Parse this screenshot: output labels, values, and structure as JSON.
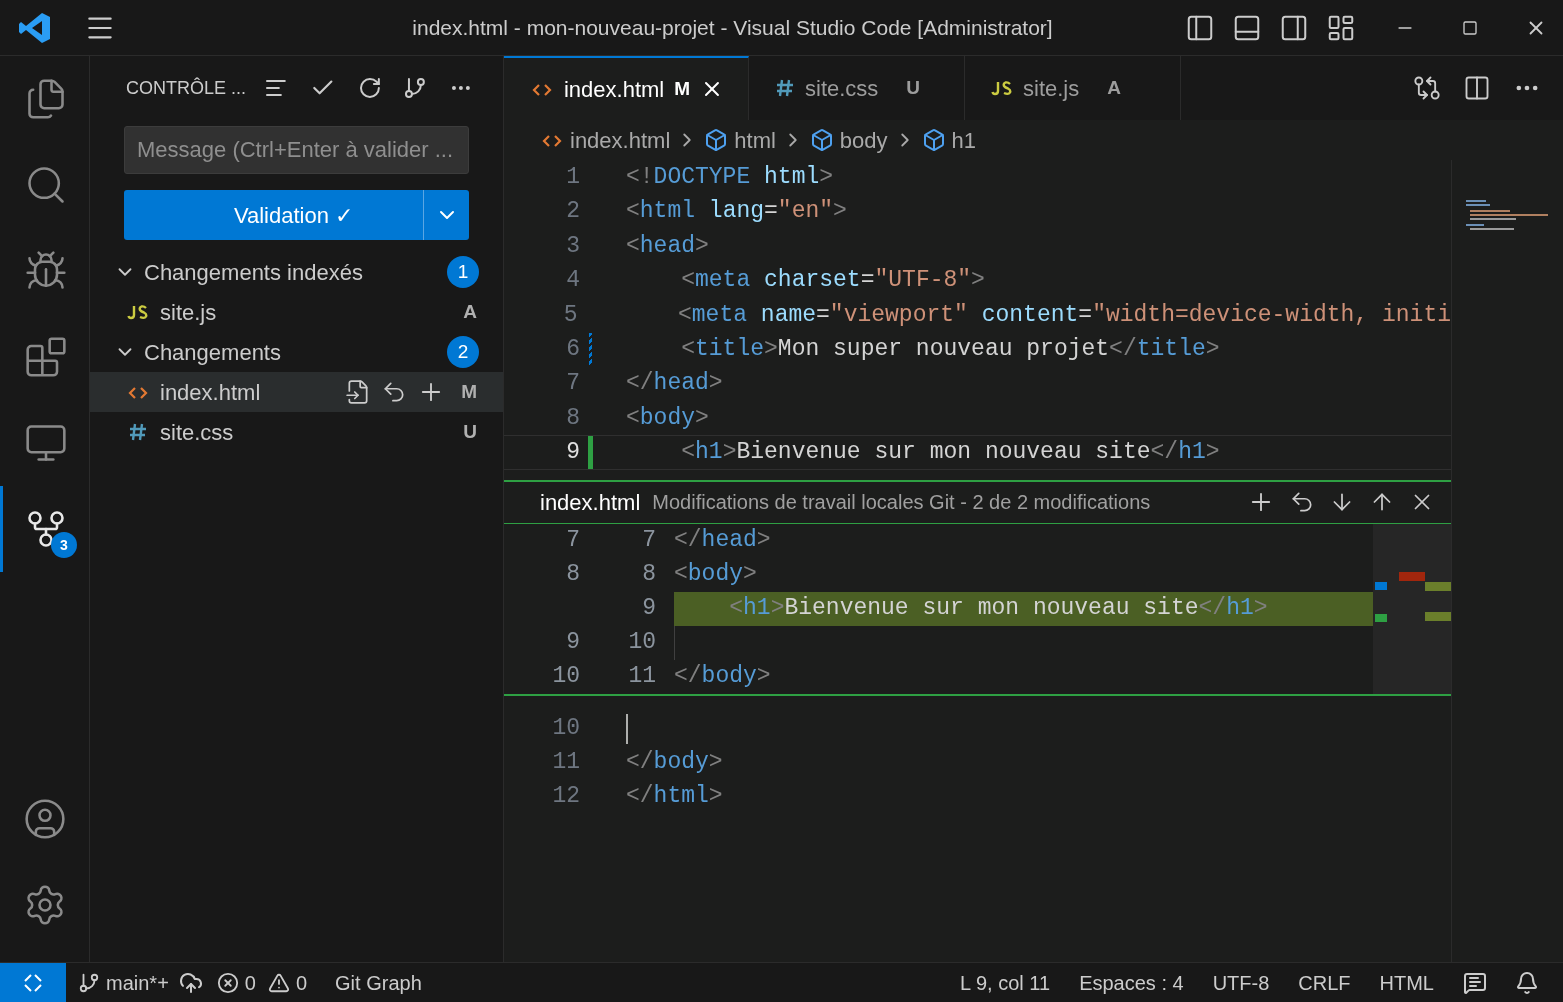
{
  "title_bar": {
    "title": "index.html - mon-nouveau-projet - Visual Studio Code [Administrator]"
  },
  "activity_bar": {
    "items": [
      {
        "kind": "explorer",
        "selected": false
      },
      {
        "kind": "search",
        "selected": false
      },
      {
        "kind": "debug",
        "selected": false
      },
      {
        "kind": "extensions",
        "selected": false
      },
      {
        "kind": "remote",
        "selected": false
      },
      {
        "kind": "scm",
        "selected": true,
        "badge": "3"
      }
    ],
    "bottom": [
      {
        "kind": "account"
      },
      {
        "kind": "settings"
      }
    ]
  },
  "sidebar": {
    "title": "CONTRÔLE ...",
    "message": {
      "placeholder": "Message (Ctrl+Enter à valider ..."
    },
    "commit_button": "Validation ✓",
    "groups": [
      {
        "label": "Changements indexés",
        "count": "1",
        "expanded": true,
        "files": [
          {
            "name": "site.js",
            "kind": "js",
            "status": "A",
            "selected": false
          }
        ]
      },
      {
        "label": "Changements",
        "count": "2",
        "expanded": true,
        "files": [
          {
            "name": "index.html",
            "kind": "html",
            "status": "M",
            "selected": true
          },
          {
            "name": "site.css",
            "kind": "css",
            "status": "U",
            "selected": false
          }
        ]
      }
    ]
  },
  "tabs": [
    {
      "label": "index.html",
      "kind": "html",
      "status": "M",
      "selected": true
    },
    {
      "label": "site.css",
      "kind": "css",
      "status": "U",
      "selected": false
    },
    {
      "label": "site.js",
      "kind": "js",
      "status": "A",
      "selected": false
    }
  ],
  "breadcrumbs": [
    {
      "label": "index.html",
      "kind": "file"
    },
    {
      "label": "html",
      "kind": "element"
    },
    {
      "label": "body",
      "kind": "element"
    },
    {
      "label": "h1",
      "kind": "element"
    }
  ],
  "editor": {
    "lines": [
      {
        "number": "1",
        "tokens": [
          {
            "kind": "bracket",
            "text": "<!"
          },
          {
            "kind": "tag",
            "text": "DOCTYPE"
          },
          {
            "kind": "attr",
            "text": " html"
          },
          {
            "kind": "bracket",
            "text": ">"
          }
        ]
      },
      {
        "number": "2",
        "tokens": [
          {
            "kind": "bracket",
            "text": "<"
          },
          {
            "kind": "tag",
            "text": "html"
          },
          {
            "kind": "attr",
            "text": " lang"
          },
          {
            "kind": "text",
            "text": "="
          },
          {
            "kind": "string",
            "text": "\"en\""
          },
          {
            "kind": "bracket",
            "text": ">"
          }
        ]
      },
      {
        "number": "3",
        "tokens": [
          {
            "kind": "bracket",
            "text": "<"
          },
          {
            "kind": "tag",
            "text": "head"
          },
          {
            "kind": "bracket",
            "text": ">"
          }
        ]
      },
      {
        "number": "4",
        "tokens": [
          {
            "kind": "bracket",
            "text": "    <"
          },
          {
            "kind": "tag",
            "text": "meta"
          },
          {
            "kind": "attr",
            "text": " charset"
          },
          {
            "kind": "text",
            "text": "="
          },
          {
            "kind": "string",
            "text": "\"UTF-8\""
          },
          {
            "kind": "bracket",
            "text": ">"
          }
        ]
      },
      {
        "number": "5",
        "tokens": [
          {
            "kind": "bracket",
            "text": "    <"
          },
          {
            "kind": "tag",
            "text": "meta"
          },
          {
            "kind": "attr",
            "text": " name"
          },
          {
            "kind": "text",
            "text": "="
          },
          {
            "kind": "string",
            "text": "\"viewport\""
          },
          {
            "kind": "attr",
            "text": " content"
          },
          {
            "kind": "text",
            "text": "="
          },
          {
            "kind": "string",
            "text": "\"width=device-width, initi"
          }
        ]
      },
      {
        "number": "6",
        "modified": true,
        "tokens": [
          {
            "kind": "bracket",
            "text": "    <"
          },
          {
            "kind": "tag",
            "text": "title"
          },
          {
            "kind": "bracket",
            "text": ">"
          },
          {
            "kind": "text",
            "text": "Mon super nouveau projet"
          },
          {
            "kind": "bracket",
            "text": "</"
          },
          {
            "kind": "tag",
            "text": "title"
          },
          {
            "kind": "bracket",
            "text": ">"
          }
        ]
      },
      {
        "number": "7",
        "tokens": [
          {
            "kind": "bracket",
            "text": "</"
          },
          {
            "kind": "tag",
            "text": "head"
          },
          {
            "kind": "bracket",
            "text": ">"
          }
        ]
      },
      {
        "number": "8",
        "tokens": [
          {
            "kind": "bracket",
            "text": "<"
          },
          {
            "kind": "tag",
            "text": "body"
          },
          {
            "kind": "bracket",
            "text": ">"
          }
        ]
      },
      {
        "number": "9",
        "added": true,
        "current": true,
        "tokens": [
          {
            "kind": "bracket",
            "text": "    <"
          },
          {
            "kind": "tag",
            "text": "h1"
          },
          {
            "kind": "bracket",
            "text": ">"
          },
          {
            "kind": "text",
            "text": "Bienvenue sur mon nouveau site"
          },
          {
            "kind": "bracket",
            "text": "</"
          },
          {
            "kind": "tag",
            "text": "h1"
          },
          {
            "kind": "bracket",
            "text": ">"
          }
        ]
      }
    ],
    "peek": {
      "file": "index.html",
      "description": "Modifications de travail locales Git - 2 de 2 modifications",
      "lines": [
        {
          "old": "7",
          "new": "7",
          "added": false,
          "tokens": [
            {
              "kind": "bracket",
              "text": "</"
            },
            {
              "kind": "tag",
              "text": "head"
            },
            {
              "kind": "bracket",
              "text": ">"
            }
          ]
        },
        {
          "old": "8",
          "new": "8",
          "added": false,
          "tokens": [
            {
              "kind": "bracket",
              "text": "<"
            },
            {
              "kind": "tag",
              "text": "body"
            },
            {
              "kind": "bracket",
              "text": ">"
            }
          ]
        },
        {
          "new": "9",
          "added": true,
          "tokens": [
            {
              "kind": "bracket",
              "text": "    <"
            },
            {
              "kind": "tag",
              "text": "h1"
            },
            {
              "kind": "bracket",
              "text": ">"
            },
            {
              "kind": "text",
              "text": "Bienvenue sur mon nouveau site"
            },
            {
              "kind": "bracket",
              "text": "</"
            },
            {
              "kind": "tag",
              "text": "h1"
            },
            {
              "kind": "bracket",
              "text": ">"
            }
          ]
        },
        {
          "old": "9",
          "new": "10",
          "added": false
        },
        {
          "old": "10",
          "new": "11",
          "added": false,
          "tokens": [
            {
              "kind": "bracket",
              "text": "</"
            },
            {
              "kind": "tag",
              "text": "body"
            },
            {
              "kind": "bracket",
              "text": ">"
            }
          ]
        }
      ]
    },
    "after_lines": [
      {
        "number": "10"
      },
      {
        "number": "11",
        "tokens": [
          {
            "kind": "bracket",
            "text": "</"
          },
          {
            "kind": "tag",
            "text": "body"
          },
          {
            "kind": "bracket",
            "text": ">"
          }
        ]
      },
      {
        "number": "12",
        "tokens": [
          {
            "kind": "bracket",
            "text": "</"
          },
          {
            "kind": "tag",
            "text": "html"
          },
          {
            "kind": "bracket",
            "text": ">"
          }
        ]
      }
    ]
  },
  "status_bar": {
    "branch": "main*+",
    "errors": "0",
    "warnings": "0",
    "git_graph": "Git Graph",
    "right": [
      "L 9, col 11",
      "Espaces : 4",
      "UTF-8",
      "CRLF",
      "HTML"
    ]
  }
}
